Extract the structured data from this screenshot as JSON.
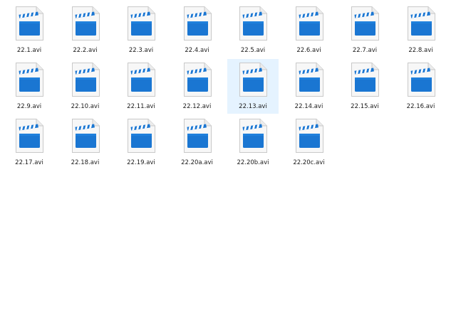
{
  "explorer": {
    "selected_index": 12,
    "colors": {
      "page_bg": "#ffffff",
      "selection_bg": "#e5f3ff",
      "doc_fill": "#f7f7f7",
      "doc_edge": "#c9c9c9",
      "clapper_blue": "#1a76d2",
      "clapper_stripe_light": "#ffffff"
    },
    "files": [
      {
        "name": "22.1.avi",
        "icon": "video-file-icon"
      },
      {
        "name": "22.2.avi",
        "icon": "video-file-icon"
      },
      {
        "name": "22.3.avi",
        "icon": "video-file-icon"
      },
      {
        "name": "22.4.avi",
        "icon": "video-file-icon"
      },
      {
        "name": "22.5.avi",
        "icon": "video-file-icon"
      },
      {
        "name": "22.6.avi",
        "icon": "video-file-icon"
      },
      {
        "name": "22.7.avi",
        "icon": "video-file-icon"
      },
      {
        "name": "22.8.avi",
        "icon": "video-file-icon"
      },
      {
        "name": "22.9.avi",
        "icon": "video-file-icon"
      },
      {
        "name": "22.10.avi",
        "icon": "video-file-icon"
      },
      {
        "name": "22.11.avi",
        "icon": "video-file-icon"
      },
      {
        "name": "22.12.avi",
        "icon": "video-file-icon"
      },
      {
        "name": "22.13.avi",
        "icon": "video-file-icon"
      },
      {
        "name": "22.14.avi",
        "icon": "video-file-icon"
      },
      {
        "name": "22.15.avi",
        "icon": "video-file-icon"
      },
      {
        "name": "22.16.avi",
        "icon": "video-file-icon"
      },
      {
        "name": "22.17.avi",
        "icon": "video-file-icon"
      },
      {
        "name": "22.18.avi",
        "icon": "video-file-icon"
      },
      {
        "name": "22.19.avi",
        "icon": "video-file-icon"
      },
      {
        "name": "22.20a.avi",
        "icon": "video-file-icon"
      },
      {
        "name": "22.20b.avi",
        "icon": "video-file-icon"
      },
      {
        "name": "22.20c.avi",
        "icon": "video-file-icon"
      }
    ]
  }
}
